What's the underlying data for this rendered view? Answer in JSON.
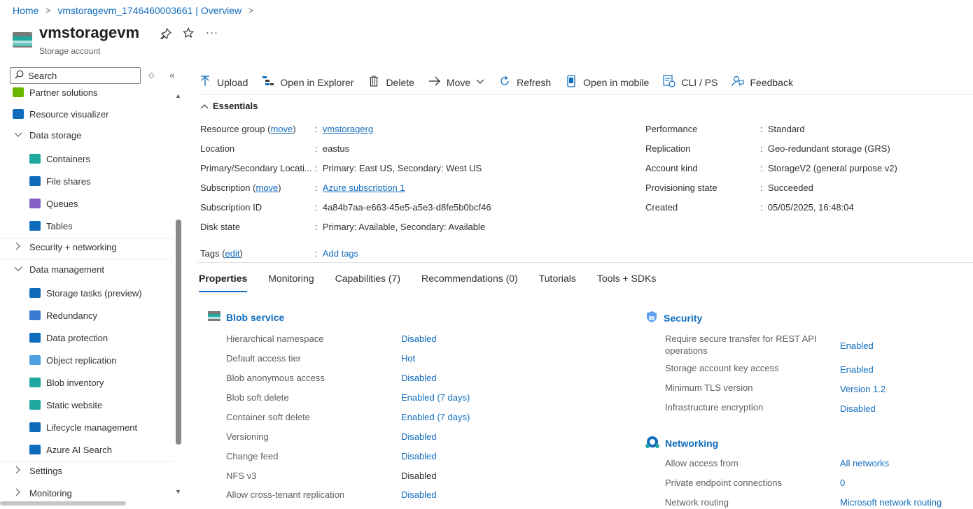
{
  "breadcrumb": {
    "home": "Home",
    "resource": "vmstoragevm_1746460003661 | Overview"
  },
  "header": {
    "title": "vmstoragevm",
    "subtitle": "Storage account"
  },
  "search": {
    "placeholder": "Search"
  },
  "sidebar": {
    "items": [
      {
        "label": "Partner solutions",
        "icon": "partner-icon"
      },
      {
        "label": "Resource visualizer",
        "icon": "visualizer-icon"
      },
      {
        "label": "Data storage",
        "group": true,
        "expanded": true
      },
      {
        "label": "Containers",
        "icon": "containers-icon"
      },
      {
        "label": "File shares",
        "icon": "file-shares-icon"
      },
      {
        "label": "Queues",
        "icon": "queues-icon"
      },
      {
        "label": "Tables",
        "icon": "tables-icon"
      },
      {
        "label": "Security + networking",
        "group": true,
        "expanded": false
      },
      {
        "label": "Data management",
        "group": true,
        "expanded": true
      },
      {
        "label": "Storage tasks (preview)",
        "icon": "storage-tasks-icon"
      },
      {
        "label": "Redundancy",
        "icon": "redundancy-icon"
      },
      {
        "label": "Data protection",
        "icon": "shield-icon"
      },
      {
        "label": "Object replication",
        "icon": "replication-icon"
      },
      {
        "label": "Blob inventory",
        "icon": "inventory-icon"
      },
      {
        "label": "Static website",
        "icon": "website-icon"
      },
      {
        "label": "Lifecycle management",
        "icon": "lifecycle-icon"
      },
      {
        "label": "Azure AI Search",
        "icon": "ai-search-icon"
      },
      {
        "label": "Settings",
        "group": true,
        "expanded": false
      },
      {
        "label": "Monitoring",
        "group": true,
        "expanded": false
      }
    ]
  },
  "toolbar": {
    "upload": "Upload",
    "open_explorer": "Open in Explorer",
    "delete": "Delete",
    "move": "Move",
    "refresh": "Refresh",
    "open_mobile": "Open in mobile",
    "cli": "CLI / PS",
    "feedback": "Feedback"
  },
  "essentials": {
    "header": "Essentials",
    "left": {
      "resource_group_label": "Resource group (",
      "move_link": "move",
      "close_paren": ")",
      "resource_group_value": "vmstoragerg",
      "location_label": "Location",
      "location_value": "eastus",
      "primary_secondary_label": "Primary/Secondary Locati...",
      "primary_secondary_value": "Primary: East US, Secondary: West US",
      "subscription_label": "Subscription (",
      "subscription_value": "Azure subscription 1",
      "subscription_id_label": "Subscription ID",
      "subscription_id_value": "4a84b7aa-e663-45e5-a5e3-d8fe5b0bcf46",
      "disk_state_label": "Disk state",
      "disk_state_value": "Primary: Available, Secondary: Available",
      "tags_label": "Tags (",
      "tags_edit": "edit",
      "tags_value": "Add tags"
    },
    "right": {
      "performance_label": "Performance",
      "performance_value": "Standard",
      "replication_label": "Replication",
      "replication_value": "Geo-redundant storage (GRS)",
      "account_kind_label": "Account kind",
      "account_kind_value": "StorageV2 (general purpose v2)",
      "provisioning_label": "Provisioning state",
      "provisioning_value": "Succeeded",
      "created_label": "Created",
      "created_value": "05/05/2025, 16:48:04"
    }
  },
  "tabs": [
    "Properties",
    "Monitoring",
    "Capabilities (7)",
    "Recommendations (0)",
    "Tutorials",
    "Tools + SDKs"
  ],
  "blob_service": {
    "title": "Blob service",
    "rows": [
      {
        "label": "Hierarchical namespace",
        "value": "Disabled",
        "link": true
      },
      {
        "label": "Default access tier",
        "value": "Hot",
        "link": true
      },
      {
        "label": "Blob anonymous access",
        "value": "Disabled",
        "link": true
      },
      {
        "label": "Blob soft delete",
        "value": "Enabled (7 days)",
        "link": true
      },
      {
        "label": "Container soft delete",
        "value": "Enabled (7 days)",
        "link": true
      },
      {
        "label": "Versioning",
        "value": "Disabled",
        "link": true
      },
      {
        "label": "Change feed",
        "value": "Disabled",
        "link": true
      },
      {
        "label": "NFS v3",
        "value": "Disabled",
        "link": false
      },
      {
        "label": "Allow cross-tenant replication",
        "value": "Disabled",
        "link": true
      }
    ]
  },
  "security": {
    "title": "Security",
    "rows": [
      {
        "label": "Require secure transfer for REST API operations",
        "value": "Enabled"
      },
      {
        "label": "Storage account key access",
        "value": "Enabled"
      },
      {
        "label": "Minimum TLS version",
        "value": "Version 1.2"
      },
      {
        "label": "Infrastructure encryption",
        "value": "Disabled"
      }
    ]
  },
  "networking": {
    "title": "Networking",
    "rows": [
      {
        "label": "Allow access from",
        "value": "All networks"
      },
      {
        "label": "Private endpoint connections",
        "value": "0"
      },
      {
        "label": "Network routing",
        "value": "Microsoft network routing"
      }
    ]
  },
  "colors": {
    "accent": "#0f6cbd",
    "text": "#323130",
    "muted": "#605e5c"
  }
}
